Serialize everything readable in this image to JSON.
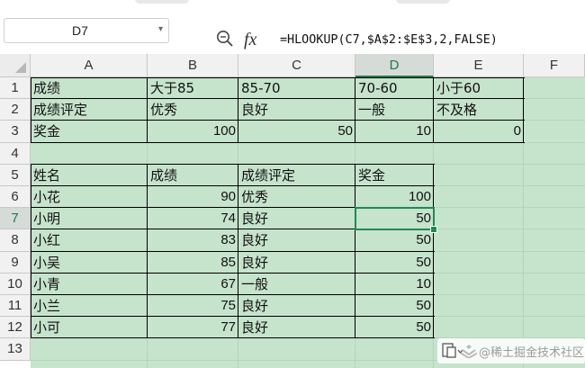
{
  "formula_bar": {
    "name_box": "D7",
    "zoom_icon": "formula-zoom-icon",
    "fx_label": "fx",
    "formula": "=HLOOKUP(C7,$A$2:$E$3,2,FALSE)"
  },
  "sheet": {
    "active_column": "D",
    "active_row": "7",
    "columns": [
      "A",
      "B",
      "C",
      "D",
      "E",
      "F"
    ],
    "rows": [
      "1",
      "2",
      "3",
      "4",
      "5",
      "6",
      "7",
      "8",
      "9",
      "10",
      "11",
      "12",
      "13"
    ],
    "cells": {
      "A1": "成绩",
      "B1": "大于85",
      "C1": "85-70",
      "D1": "70-60",
      "E1": "小于60",
      "A2": "成绩评定",
      "B2": "优秀",
      "C2": "良好",
      "D2": "一般",
      "E2": "不及格",
      "A3": "奖金",
      "B3": "100",
      "C3": "50",
      "D3": "10",
      "E3": "0",
      "A5": "姓名",
      "B5": "成绩",
      "C5": "成绩评定",
      "D5": "奖金",
      "A6": "小花",
      "B6": "90",
      "C6": "优秀",
      "D6": "100",
      "A7": "小明",
      "B7": "74",
      "C7": "良好",
      "D7": "50",
      "A8": "小红",
      "B8": "83",
      "C8": "良好",
      "D8": "50",
      "A9": "小吴",
      "B9": "85",
      "C9": "良好",
      "D9": "50",
      "A10": "小青",
      "B10": "67",
      "C10": "一般",
      "D10": "10",
      "A11": "小兰",
      "B11": "75",
      "C11": "良好",
      "D11": "50",
      "A12": "小可",
      "B12": "77",
      "C12": "良好",
      "D12": "50"
    },
    "fill_color": "#c6e3cc",
    "selection_color": "#1f8a55"
  },
  "watermark": {
    "text": "@稀土掘金技术社区",
    "icon": "paste-options-icon"
  }
}
